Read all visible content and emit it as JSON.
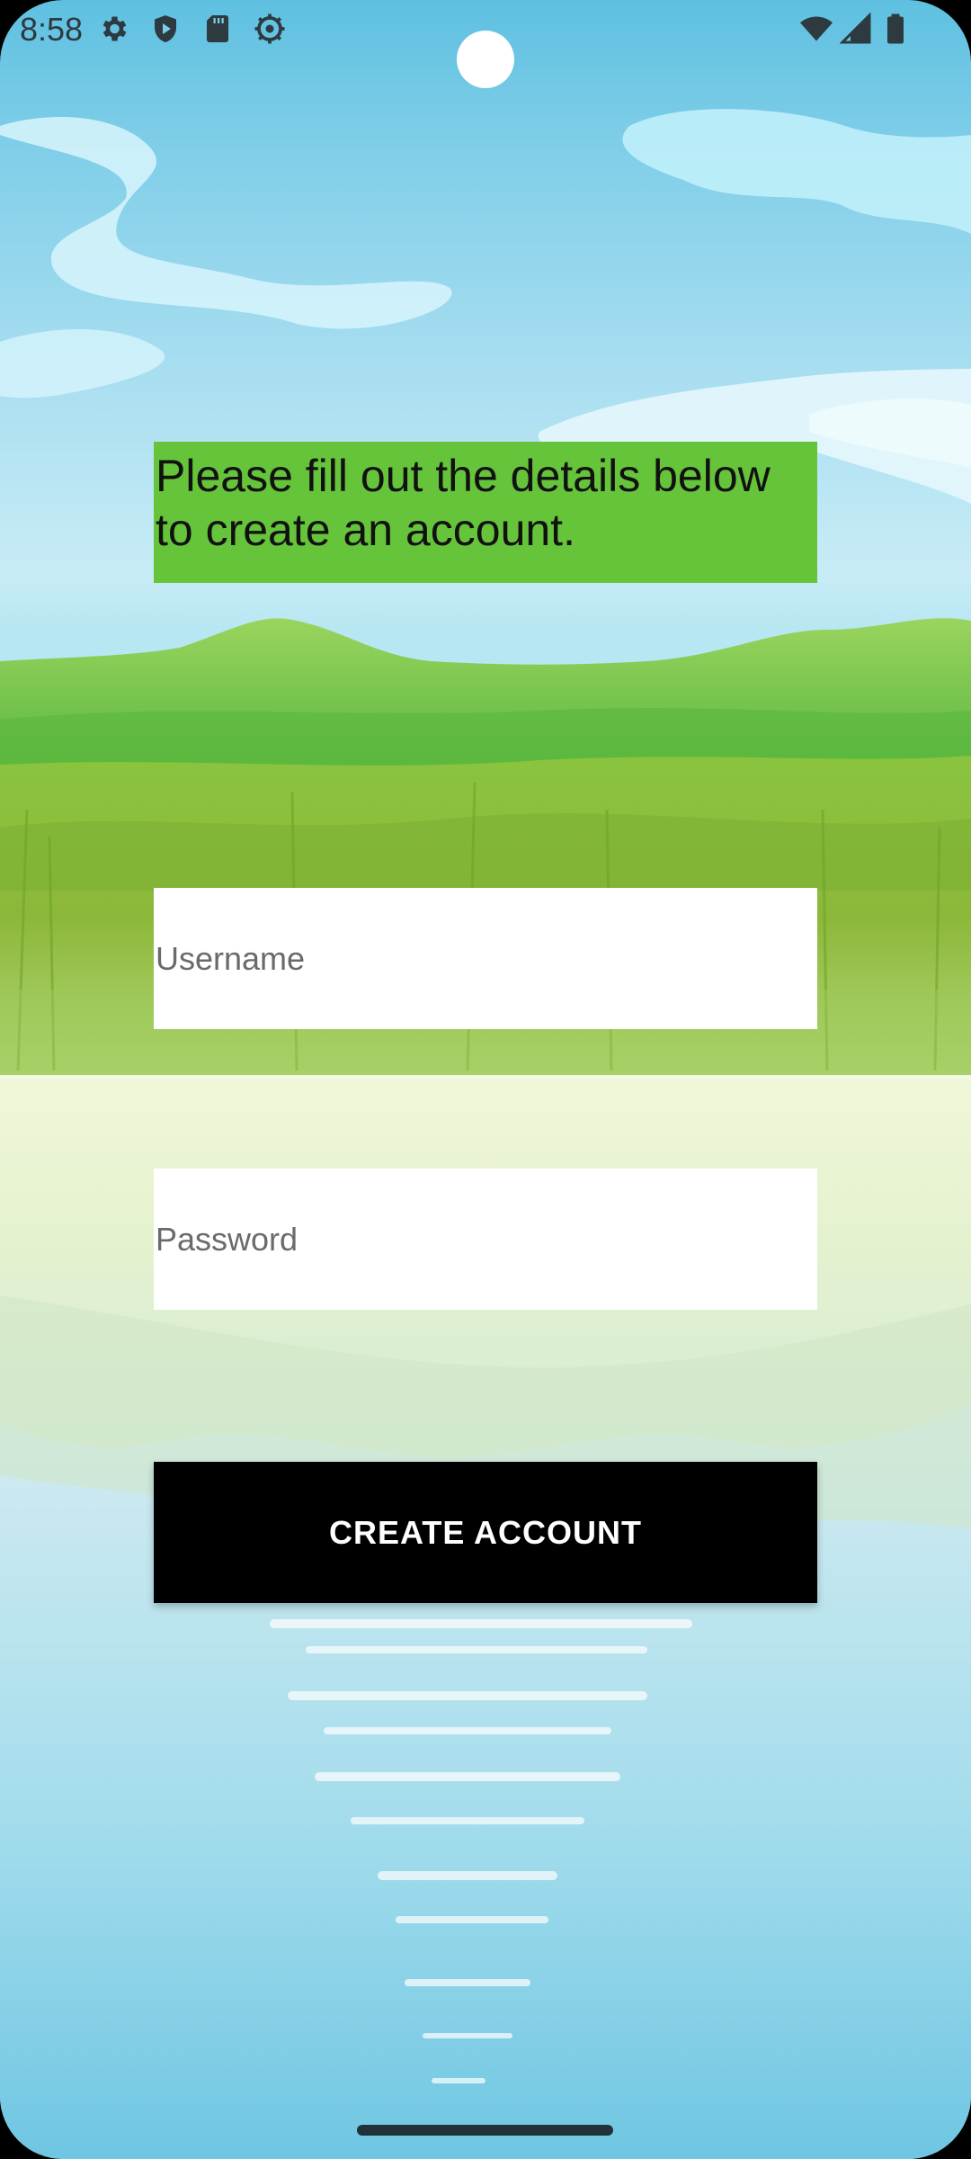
{
  "status_bar": {
    "time": "8:58",
    "left_icons": [
      "gear-icon",
      "shield-icon",
      "sd-card-icon",
      "settings-cog-icon"
    ],
    "right_icons": [
      "wifi-icon",
      "cell-signal-icon",
      "battery-icon"
    ]
  },
  "form": {
    "instructions": "Please fill out the details below to create an account.",
    "username_placeholder": "Username",
    "password_placeholder": "Password",
    "submit_label": "CREATE ACCOUNT"
  },
  "colors": {
    "instruction_bg": "#66c43a",
    "button_bg": "#000000",
    "button_text": "#ffffff",
    "field_bg": "#ffffff"
  }
}
